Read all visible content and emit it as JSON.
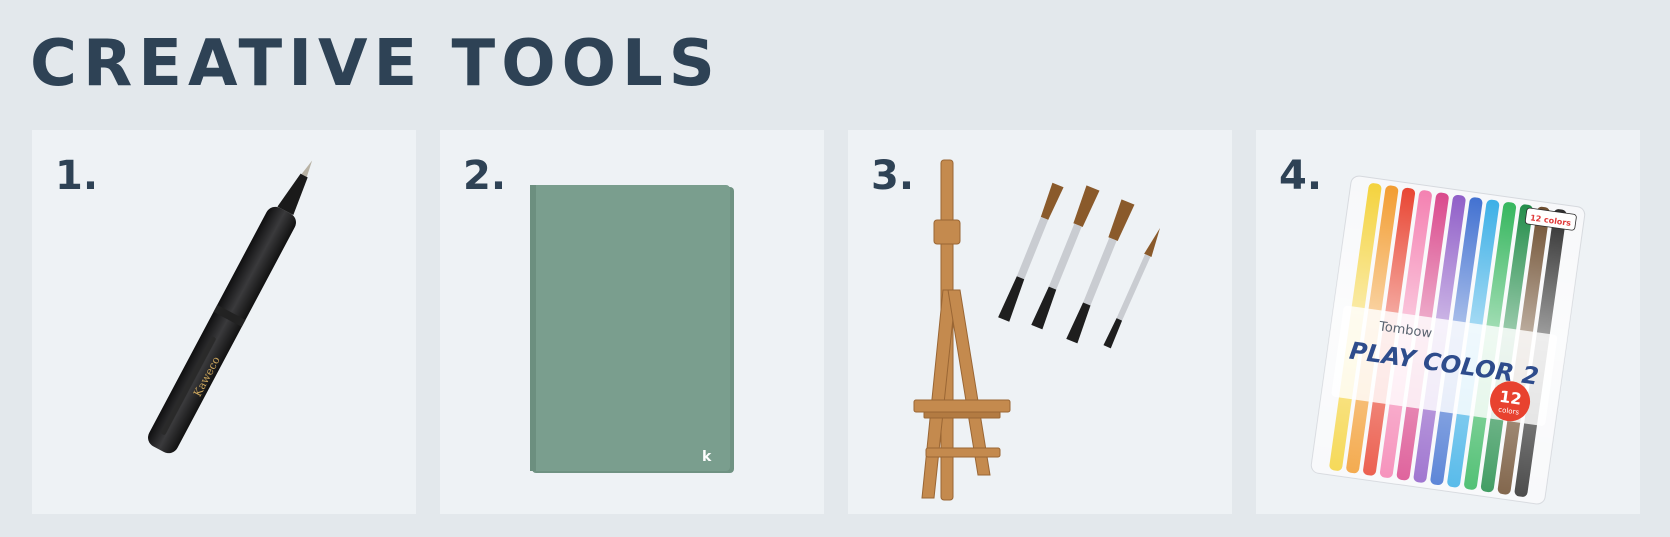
{
  "page": {
    "title": "CREATIVE TOOLS"
  },
  "colors": {
    "background": "#e3e8ec",
    "panel": "#eef2f5",
    "heading": "#2e4255"
  },
  "items": [
    {
      "number": "1.",
      "subject": "black-rollerball-pen"
    },
    {
      "number": "2.",
      "subject": "green-hardcover-notebook",
      "cover_mark": "k",
      "cover_color": "#7a9e8e"
    },
    {
      "number": "3.",
      "subject": "wooden-tabletop-easel-and-paintbrushes"
    },
    {
      "number": "4.",
      "subject": "pack-of-colored-markers",
      "brand": "Tombow",
      "product": "PLAY COLOR 2",
      "badge_count": "12",
      "badge_unit": "colors",
      "tab_text": "12 colors"
    }
  ]
}
